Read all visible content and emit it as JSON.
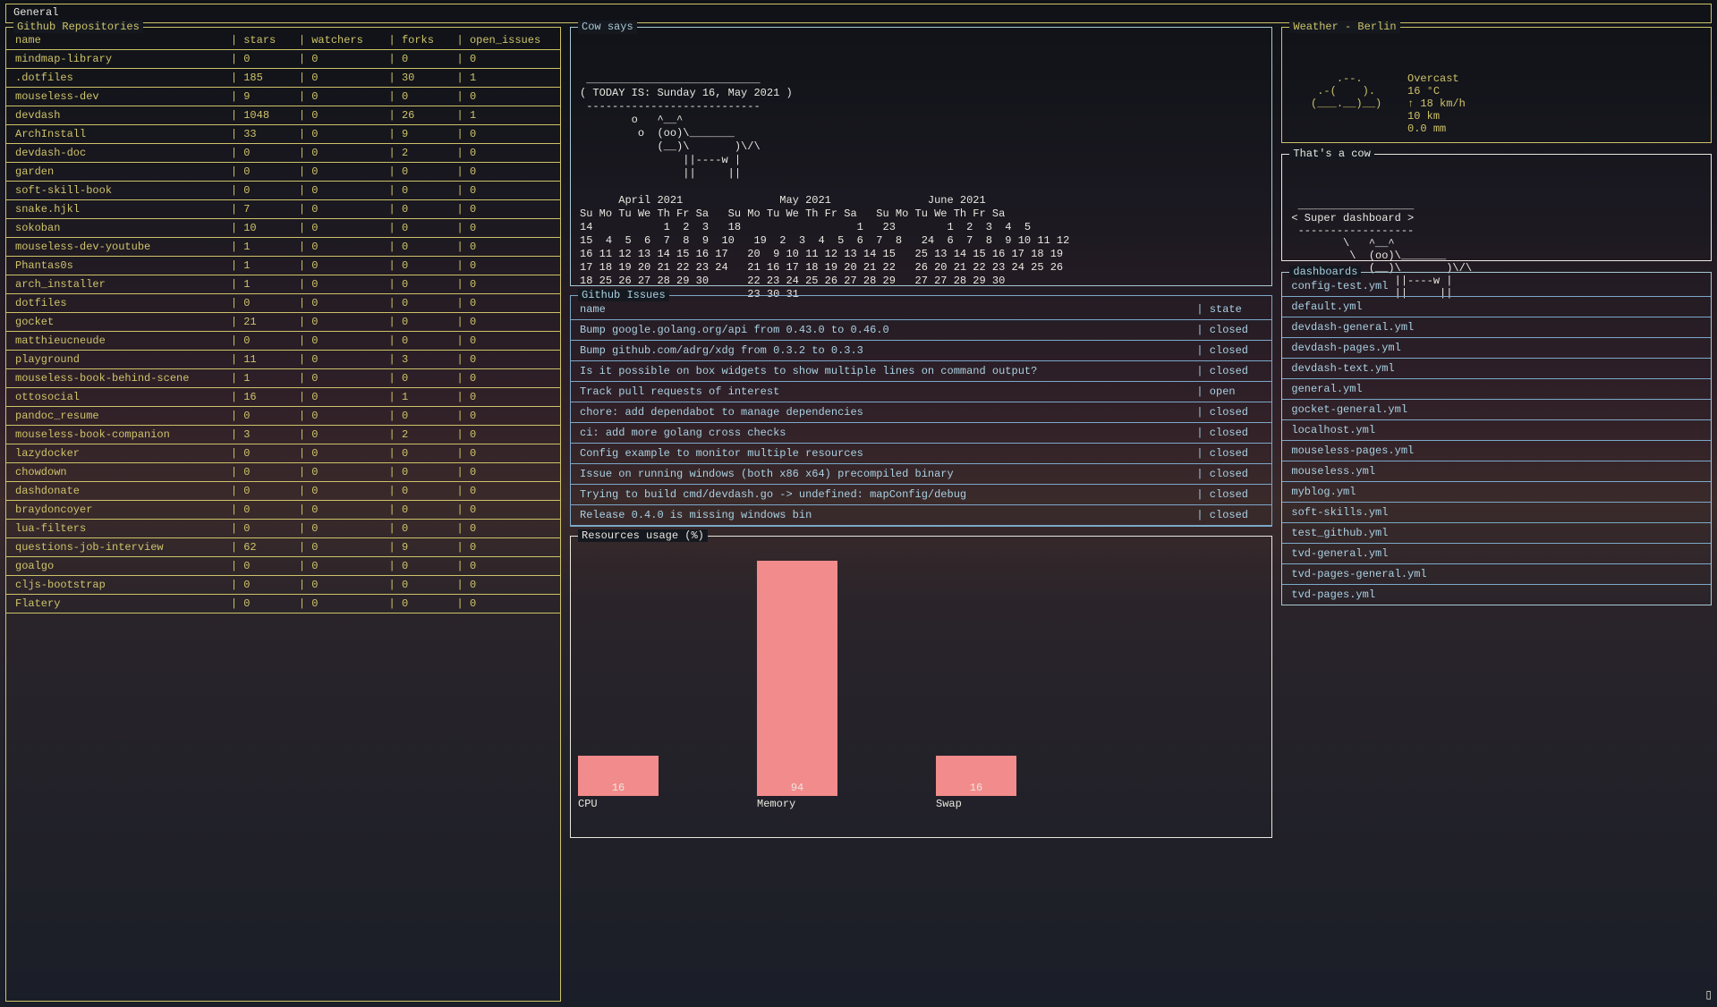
{
  "header": {
    "tab": "General"
  },
  "repos": {
    "title": "Github Repositories",
    "cols": [
      "name",
      "stars",
      "watchers",
      "forks",
      "open_issues"
    ],
    "rows": [
      {
        "name": "mindmap-library",
        "stars": "0",
        "watchers": "0",
        "forks": "0",
        "open_issues": "0"
      },
      {
        "name": ".dotfiles",
        "stars": "185",
        "watchers": "0",
        "forks": "30",
        "open_issues": "1"
      },
      {
        "name": "mouseless-dev",
        "stars": "9",
        "watchers": "0",
        "forks": "0",
        "open_issues": "0"
      },
      {
        "name": "devdash",
        "stars": "1048",
        "watchers": "0",
        "forks": "26",
        "open_issues": "1"
      },
      {
        "name": "ArchInstall",
        "stars": "33",
        "watchers": "0",
        "forks": "9",
        "open_issues": "0"
      },
      {
        "name": "devdash-doc",
        "stars": "0",
        "watchers": "0",
        "forks": "2",
        "open_issues": "0"
      },
      {
        "name": "garden",
        "stars": "0",
        "watchers": "0",
        "forks": "0",
        "open_issues": "0"
      },
      {
        "name": "soft-skill-book",
        "stars": "0",
        "watchers": "0",
        "forks": "0",
        "open_issues": "0"
      },
      {
        "name": "snake.hjkl",
        "stars": "7",
        "watchers": "0",
        "forks": "0",
        "open_issues": "0"
      },
      {
        "name": "sokoban",
        "stars": "10",
        "watchers": "0",
        "forks": "0",
        "open_issues": "0"
      },
      {
        "name": "mouseless-dev-youtube",
        "stars": "1",
        "watchers": "0",
        "forks": "0",
        "open_issues": "0"
      },
      {
        "name": "Phantas0s",
        "stars": "1",
        "watchers": "0",
        "forks": "0",
        "open_issues": "0"
      },
      {
        "name": "arch_installer",
        "stars": "1",
        "watchers": "0",
        "forks": "0",
        "open_issues": "0"
      },
      {
        "name": "dotfiles",
        "stars": "0",
        "watchers": "0",
        "forks": "0",
        "open_issues": "0"
      },
      {
        "name": "gocket",
        "stars": "21",
        "watchers": "0",
        "forks": "0",
        "open_issues": "0"
      },
      {
        "name": "matthieucneude",
        "stars": "0",
        "watchers": "0",
        "forks": "0",
        "open_issues": "0"
      },
      {
        "name": "playground",
        "stars": "11",
        "watchers": "0",
        "forks": "3",
        "open_issues": "0"
      },
      {
        "name": "mouseless-book-behind-scene",
        "stars": "1",
        "watchers": "0",
        "forks": "0",
        "open_issues": "0"
      },
      {
        "name": "ottosocial",
        "stars": "16",
        "watchers": "0",
        "forks": "1",
        "open_issues": "0"
      },
      {
        "name": "pandoc_resume",
        "stars": "0",
        "watchers": "0",
        "forks": "0",
        "open_issues": "0"
      },
      {
        "name": "mouseless-book-companion",
        "stars": "3",
        "watchers": "0",
        "forks": "2",
        "open_issues": "0"
      },
      {
        "name": "lazydocker",
        "stars": "0",
        "watchers": "0",
        "forks": "0",
        "open_issues": "0"
      },
      {
        "name": "chowdown",
        "stars": "0",
        "watchers": "0",
        "forks": "0",
        "open_issues": "0"
      },
      {
        "name": "dashdonate",
        "stars": "0",
        "watchers": "0",
        "forks": "0",
        "open_issues": "0"
      },
      {
        "name": "braydoncoyer",
        "stars": "0",
        "watchers": "0",
        "forks": "0",
        "open_issues": "0"
      },
      {
        "name": "lua-filters",
        "stars": "0",
        "watchers": "0",
        "forks": "0",
        "open_issues": "0"
      },
      {
        "name": "questions-job-interview",
        "stars": "62",
        "watchers": "0",
        "forks": "9",
        "open_issues": "0"
      },
      {
        "name": "goalgo",
        "stars": "0",
        "watchers": "0",
        "forks": "0",
        "open_issues": "0"
      },
      {
        "name": "cljs-bootstrap",
        "stars": "0",
        "watchers": "0",
        "forks": "0",
        "open_issues": "0"
      },
      {
        "name": "Flatery",
        "stars": "0",
        "watchers": "0",
        "forks": "0",
        "open_issues": "0"
      }
    ]
  },
  "cow": {
    "title": "Cow says",
    "text": " ___________________________\n( TODAY IS: Sunday 16, May 2021 )\n ---------------------------\n        o   ^__^\n         o  (oo)\\_______\n            (__)\\       )\\/\\\n                ||----w |\n                ||     ||\n\n      April 2021               May 2021               June 2021\nSu Mo Tu We Th Fr Sa   Su Mo Tu We Th Fr Sa   Su Mo Tu We Th Fr Sa\n14           1  2  3   18                  1   23        1  2  3  4  5\n15  4  5  6  7  8  9  10   19  2  3  4  5  6  7  8   24  6  7  8  9 10 11 12\n16 11 12 13 14 15 16 17   20  9 10 11 12 13 14 15   25 13 14 15 16 17 18 19\n17 18 19 20 21 22 23 24   21 16 17 18 19 20 21 22   26 20 21 22 23 24 25 26\n18 25 26 27 28 29 30      22 23 24 25 26 27 28 29   27 27 28 29 30\n                          23 30 31"
  },
  "issues": {
    "title": "Github Issues",
    "cols": [
      "name",
      "state"
    ],
    "rows": [
      {
        "name": "Bump google.golang.org/api from 0.43.0 to 0.46.0",
        "state": "closed"
      },
      {
        "name": "Bump github.com/adrg/xdg from 0.3.2 to 0.3.3",
        "state": "closed"
      },
      {
        "name": "Is it possible on box widgets to show multiple lines on command output?",
        "state": "closed"
      },
      {
        "name": "Track pull requests of interest",
        "state": "open"
      },
      {
        "name": "chore: add dependabot to manage dependencies",
        "state": "closed"
      },
      {
        "name": "ci: add more golang cross checks",
        "state": "closed"
      },
      {
        "name": "Config example to monitor multiple resources",
        "state": "closed"
      },
      {
        "name": "Issue on running windows (both x86 x64) precompiled binary",
        "state": "closed"
      },
      {
        "name": "Trying to build cmd/devdash.go -> undefined: mapConfig/debug",
        "state": "closed"
      },
      {
        "name": "Release 0.4.0 is missing windows bin",
        "state": "closed"
      }
    ]
  },
  "chart_data": {
    "type": "bar",
    "title": "Resources usage (%)",
    "categories": [
      "CPU",
      "Memory",
      "Swap"
    ],
    "values": [
      16,
      94,
      16
    ],
    "ylim": [
      0,
      100
    ],
    "ylabel": "%",
    "xlabel": ""
  },
  "weather": {
    "title": "Weather - Berlin",
    "art": "       .--.    \n    .-(    ).  \n   (___.__)__) ",
    "lines": [
      "Overcast",
      "16 °C",
      "↑ 18 km/h",
      "10 km",
      "0.0 mm"
    ]
  },
  "cow2": {
    "title": "That's a cow",
    "text": " __________________\n< Super dashboard >\n ------------------\n        \\   ^__^\n         \\  (oo)\\_______\n            (__)\\       )\\/\\\n                ||----w |\n                ||     ||"
  },
  "dashboards": {
    "title": "dashboards",
    "items": [
      "config-test.yml",
      "default.yml",
      "devdash-general.yml",
      "devdash-pages.yml",
      "devdash-text.yml",
      "general.yml",
      "gocket-general.yml",
      "localhost.yml",
      "mouseless-pages.yml",
      "mouseless.yml",
      "myblog.yml",
      "soft-skills.yml",
      "test_github.yml",
      "tvd-general.yml",
      "tvd-pages-general.yml",
      "tvd-pages.yml"
    ]
  }
}
